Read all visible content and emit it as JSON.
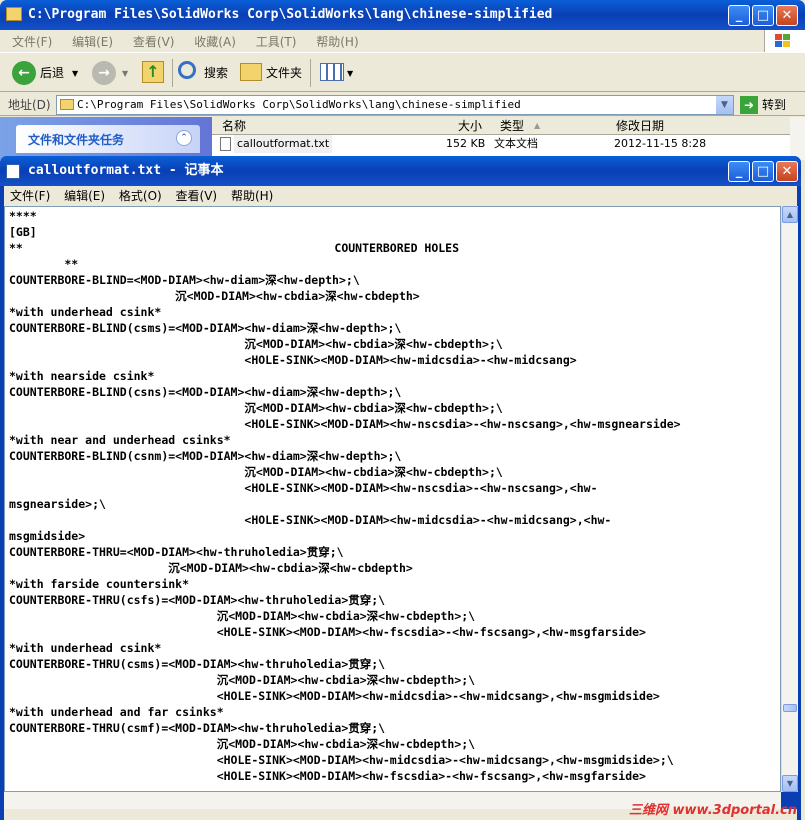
{
  "explorer": {
    "title": "C:\\Program Files\\SolidWorks Corp\\SolidWorks\\lang\\chinese-simplified",
    "menu": [
      "文件(F)",
      "编辑(E)",
      "查看(V)",
      "收藏(A)",
      "工具(T)",
      "帮助(H)"
    ],
    "toolbar": {
      "back": "后退",
      "search": "搜索",
      "folders": "文件夹"
    },
    "address_label": "地址(D)",
    "address_value": "C:\\Program Files\\SolidWorks Corp\\SolidWorks\\lang\\chinese-simplified",
    "go_label": "转到",
    "task_pane_title": "文件和文件夹任务",
    "columns": {
      "name": "名称",
      "size": "大小",
      "type": "类型",
      "modified": "修改日期"
    },
    "file": {
      "name": "calloutformat.txt",
      "size": "152 KB",
      "type": "文本文档",
      "modified": "2012-11-15 8:28"
    }
  },
  "notepad": {
    "title": "calloutformat.txt - 记事本",
    "menu": [
      "文件(F)",
      "编辑(E)",
      "格式(O)",
      "查看(V)",
      "帮助(H)"
    ],
    "lines": [
      "****",
      "[GB]",
      "**                                             COUNTERBORED HOLES",
      "        **",
      "COUNTERBORE-BLIND=<MOD-DIAM><hw-diam>深<hw-depth>;\\",
      "                        沉<MOD-DIAM><hw-cbdia>深<hw-cbdepth>",
      "*with underhead csink*",
      "COUNTERBORE-BLIND(csms)=<MOD-DIAM><hw-diam>深<hw-depth>;\\",
      "                                  沉<MOD-DIAM><hw-cbdia>深<hw-cbdepth>;\\",
      "                                  <HOLE-SINK><MOD-DIAM><hw-midcsdia>-<hw-midcsang>",
      "*with nearside csink*",
      "COUNTERBORE-BLIND(csns)=<MOD-DIAM><hw-diam>深<hw-depth>;\\",
      "                                  沉<MOD-DIAM><hw-cbdia>深<hw-cbdepth>;\\",
      "                                  <HOLE-SINK><MOD-DIAM><hw-nscsdia>-<hw-nscsang>,<hw-msgnearside>",
      "*with near and underhead csinks*",
      "COUNTERBORE-BLIND(csnm)=<MOD-DIAM><hw-diam>深<hw-depth>;\\",
      "                                  沉<MOD-DIAM><hw-cbdia>深<hw-cbdepth>;\\",
      "                                  <HOLE-SINK><MOD-DIAM><hw-nscsdia>-<hw-nscsang>,<hw-",
      "msgnearside>;\\",
      "                                  <HOLE-SINK><MOD-DIAM><hw-midcsdia>-<hw-midcsang>,<hw-",
      "msgmidside>",
      "COUNTERBORE-THRU=<MOD-DIAM><hw-thruholedia>贯穿;\\",
      "                       沉<MOD-DIAM><hw-cbdia>深<hw-cbdepth>",
      "*with farside countersink*",
      "COUNTERBORE-THRU(csfs)=<MOD-DIAM><hw-thruholedia>贯穿;\\",
      "                              沉<MOD-DIAM><hw-cbdia>深<hw-cbdepth>;\\",
      "                              <HOLE-SINK><MOD-DIAM><hw-fscsdia>-<hw-fscsang>,<hw-msgfarside>",
      "*with underhead csink*",
      "COUNTERBORE-THRU(csms)=<MOD-DIAM><hw-thruholedia>贯穿;\\",
      "                              沉<MOD-DIAM><hw-cbdia>深<hw-cbdepth>;\\",
      "                              <HOLE-SINK><MOD-DIAM><hw-midcsdia>-<hw-midcsang>,<hw-msgmidside>",
      "*with underhead and far csinks*",
      "COUNTERBORE-THRU(csmf)=<MOD-DIAM><hw-thruholedia>贯穿;\\",
      "                              沉<MOD-DIAM><hw-cbdia>深<hw-cbdepth>;\\",
      "                              <HOLE-SINK><MOD-DIAM><hw-midcsdia>-<hw-midcsang>,<hw-msgmidside>;\\",
      "                              <HOLE-SINK><MOD-DIAM><hw-fscsdia>-<hw-fscsang>,<hw-msgfarside>"
    ]
  },
  "watermark": "三维网 www.3dportal.cn",
  "colors": {
    "titlebar": "#0a3fb4",
    "chrome": "#ece9d8",
    "close": "#c4441e"
  }
}
